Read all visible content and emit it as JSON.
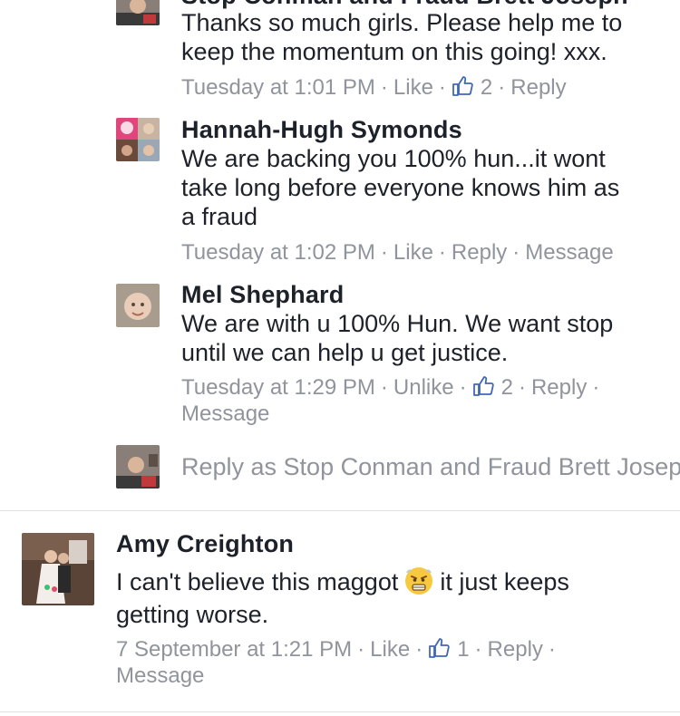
{
  "thread": {
    "reply1": {
      "author": "Stop Conman and Fraud Brett Joseph",
      "line1": "Thanks so much girls. Please help me to",
      "line2": "keep the momentum on this going! xxx.",
      "time": "Tuesday at 1:01 PM",
      "action_like": "Like",
      "like_count": "2",
      "action_reply": "Reply",
      "avatar_icon": "profile-photo-man-icon"
    },
    "reply2": {
      "author": "Hannah-Hugh Symonds",
      "line1": "We are backing you 100% hun...it wont",
      "line2": "take long before everyone knows him as",
      "line3": "a fraud",
      "time": "Tuesday at 1:02 PM",
      "action_like": "Like",
      "action_reply": "Reply",
      "action_message": "Message",
      "avatar_icon": "profile-collage-icon"
    },
    "reply3": {
      "author": "Mel Shephard",
      "line1": "We are with u 100% Hun. We want stop",
      "line2": "until we can help u get justice.",
      "time": "Tuesday at 1:29 PM",
      "action_unlike": "Unlike",
      "like_count": "2",
      "action_reply": "Reply",
      "action_message": "Message",
      "avatar_icon": "profile-photo-baby-icon"
    },
    "reply_box": {
      "placeholder": "Reply as Stop Conman and Fraud Brett Joseph",
      "avatar_icon": "profile-photo-man-icon"
    }
  },
  "comment": {
    "author": "Amy Creighton",
    "line1_before": "I can't believe this maggot",
    "emoji": "angry-face-emoji-icon",
    "line1_after": "it just keeps",
    "line2": "getting worse.",
    "time": "7 September at 1:21 PM",
    "action_like": "Like",
    "like_count": "1",
    "action_reply": "Reply",
    "action_message": "Message",
    "avatar_icon": "profile-photo-wedding-icon"
  },
  "colors": {
    "text": "#1d2129",
    "meta": "#90949c",
    "link_blue": "#4267b2",
    "divider": "#dddfe2"
  }
}
